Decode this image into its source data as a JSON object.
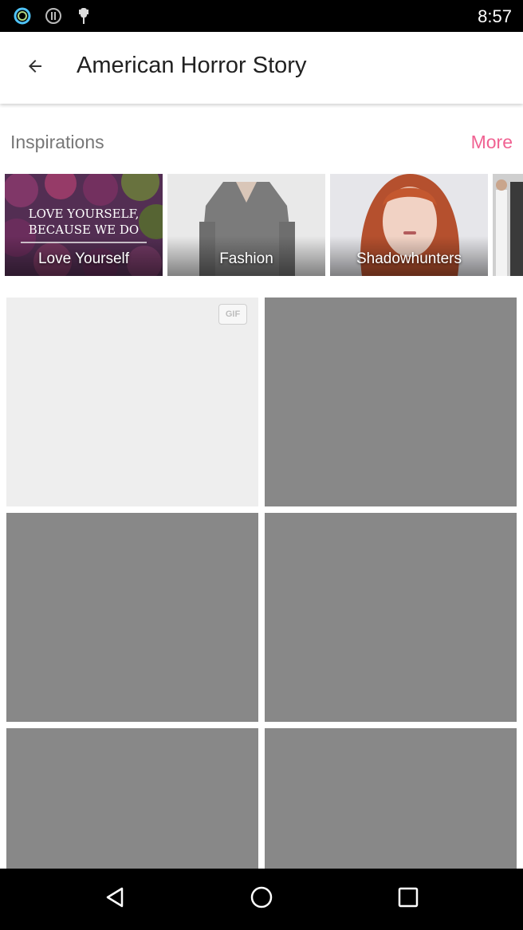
{
  "status_bar": {
    "time": "8:57",
    "icons": [
      "ring-app-icon",
      "pause-icon",
      "android-debug-icon"
    ]
  },
  "app_bar": {
    "back_icon": "arrow-left-icon",
    "title": "American Horror Story"
  },
  "inspirations": {
    "label": "Inspirations",
    "more_label": "More",
    "items": [
      {
        "label": "Love Yourself",
        "image_text_line1": "LOVE YOURSELF,",
        "image_text_line2": "BECAUSE WE DO"
      },
      {
        "label": "Fashion"
      },
      {
        "label": "Shadowhunters"
      },
      {
        "label": ""
      }
    ]
  },
  "grid": {
    "gif_badge": "GIF"
  },
  "nav_bar": {
    "icons": [
      "back-triangle-icon",
      "home-circle-icon",
      "recents-square-icon"
    ]
  },
  "colors": {
    "accent": "#f06292",
    "placeholder_gray": "#888888",
    "placeholder_light": "#eeeeee"
  }
}
